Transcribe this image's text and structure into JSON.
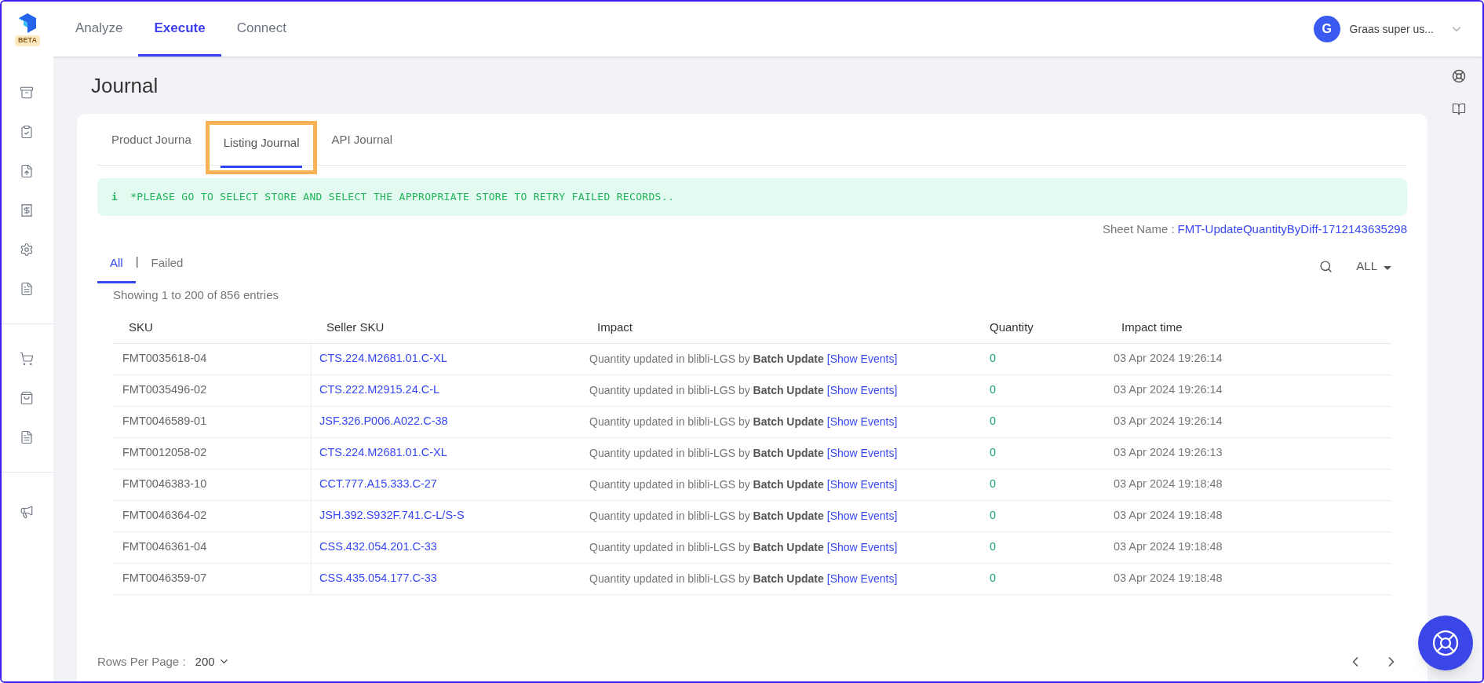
{
  "logo": {
    "badge": "BETA"
  },
  "nav": [
    {
      "label": "Analyze",
      "selected": false
    },
    {
      "label": "Execute",
      "selected": true
    },
    {
      "label": "Connect",
      "selected": false
    }
  ],
  "user": {
    "initial": "G",
    "name": "Graas super us..."
  },
  "page_title": "Journal",
  "journal_tabs": [
    {
      "label": "Product Journa",
      "selected": false,
      "highlighted": false
    },
    {
      "label": "Listing Journal",
      "selected": true,
      "highlighted": true
    },
    {
      "label": "API Journal",
      "selected": false,
      "highlighted": false
    }
  ],
  "alert": {
    "icon": "i",
    "text": "*PLEASE GO TO SELECT STORE AND SELECT THE APPROPRIATE STORE TO RETRY FAILED RECORDS.."
  },
  "sheet": {
    "label": "Sheet Name :",
    "value": "FMT-UpdateQuantityByDiff-1712143635298"
  },
  "filters": [
    {
      "label": "All",
      "selected": true
    },
    {
      "label": "Failed",
      "selected": false
    }
  ],
  "filter_separator": "|",
  "status_dropdown": "ALL",
  "showing": "Showing 1 to 200 of 856 entries",
  "columns": [
    "SKU",
    "Seller SKU",
    "Impact",
    "Quantity",
    "Impact time"
  ],
  "rows": [
    {
      "sku": "FMT0035618-04",
      "seller_sku": "CTS.224.M2681.01.C-XL",
      "impact": "Quantity updated in blibli-LGS by **Batch Update**",
      "link": "[Show Events]",
      "quantity": "0",
      "time": "03 Apr 2024 19:26:14"
    },
    {
      "sku": "FMT0035496-02",
      "seller_sku": "CTS.222.M2915.24.C-L",
      "impact": "Quantity updated in blibli-LGS by **Batch Update**",
      "link": "[Show Events]",
      "quantity": "0",
      "time": "03 Apr 2024 19:26:14"
    },
    {
      "sku": "FMT0046589-01",
      "seller_sku": "JSF.326.P006.A022.C-38",
      "impact": "Quantity updated in blibli-LGS by **Batch Update**",
      "link": "[Show Events]",
      "quantity": "0",
      "time": "03 Apr 2024 19:26:14"
    },
    {
      "sku": "FMT0012058-02",
      "seller_sku": "CTS.224.M2681.01.C-XL",
      "impact": "Quantity updated in blibli-LGS by **Batch Update**",
      "link": "[Show Events]",
      "quantity": "0",
      "time": "03 Apr 2024 19:26:13"
    },
    {
      "sku": "FMT0046383-10",
      "seller_sku": "CCT.777.A15.333.C-27",
      "impact": "Quantity updated in blibli-LGS by **Batch Update**",
      "link": "[Show Events]",
      "quantity": "0",
      "time": "03 Apr 2024 19:18:48"
    },
    {
      "sku": "FMT0046364-02",
      "seller_sku": "JSH.392.S932F.741.C-L/S-S",
      "impact": "Quantity updated in blibli-LGS by **Batch Update**",
      "link": "[Show Events]",
      "quantity": "0",
      "time": "03 Apr 2024 19:18:48"
    },
    {
      "sku": "FMT0046361-04",
      "seller_sku": "CSS.432.054.201.C-33",
      "impact": "Quantity updated in blibli-LGS by **Batch Update**",
      "link": "[Show Events]",
      "quantity": "0",
      "time": "03 Apr 2024 19:18:48"
    },
    {
      "sku": "FMT0046359-07",
      "seller_sku": "CSS.435.054.177.C-33",
      "impact": "Quantity updated in blibli-LGS by **Batch Update**",
      "link": "[Show Events]",
      "quantity": "0",
      "time": "03 Apr 2024 19:18:48"
    }
  ],
  "rows_per_page": {
    "label": "Rows Per Page :",
    "value": "200"
  }
}
